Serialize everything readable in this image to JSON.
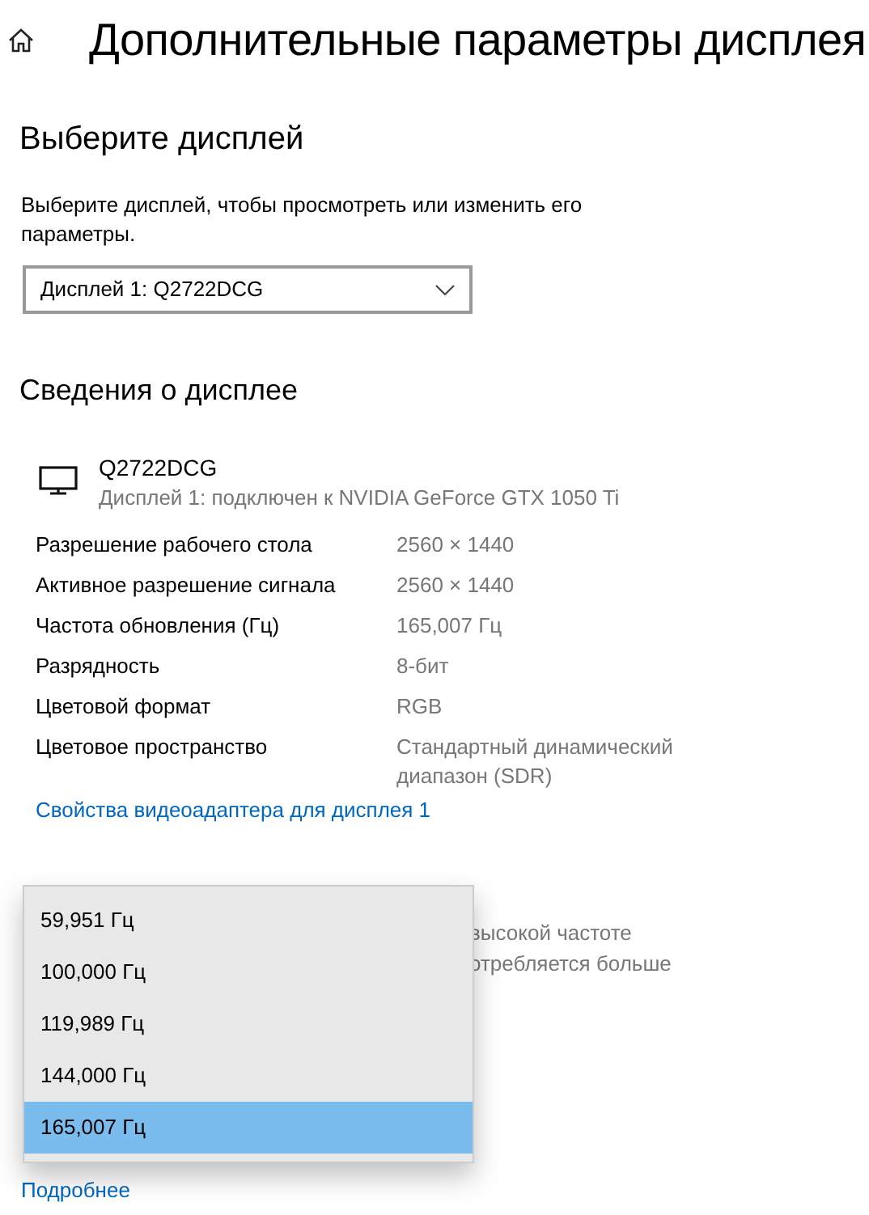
{
  "header": {
    "title": "Дополнительные параметры дисплея"
  },
  "choose_display": {
    "heading": "Выберите дисплей",
    "description": "Выберите дисплей, чтобы просмотреть или изменить его параметры.",
    "dropdown_value": "Дисплей 1: Q2722DCG"
  },
  "display_info": {
    "heading": "Сведения о дисплее",
    "monitor_name": "Q2722DCG",
    "monitor_detail": "Дисплей 1: подключен к NVIDIA GeForce GTX 1050 Ti",
    "rows": [
      {
        "label": "Разрешение рабочего стола",
        "value": "2560 × 1440"
      },
      {
        "label": "Активное разрешение сигнала",
        "value": "2560 × 1440"
      },
      {
        "label": "Частота обновления (Гц)",
        "value": "165,007 Гц"
      },
      {
        "label": "Разрядность",
        "value": "8-бит"
      },
      {
        "label": "Цветовой формат",
        "value": "RGB"
      },
      {
        "label": "Цветовое пространство",
        "value": "Стандартный динамический диапазон (SDR)"
      }
    ],
    "adapter_link": "Свойства видеоадаптера для дисплея 1"
  },
  "refresh_rate": {
    "description_fragments": [
      "высокой частоте",
      "отребляется больше"
    ],
    "options": [
      {
        "label": "59,951 Гц",
        "selected": false
      },
      {
        "label": "100,000 Гц",
        "selected": false
      },
      {
        "label": "119,989 Гц",
        "selected": false
      },
      {
        "label": "144,000 Гц",
        "selected": false
      },
      {
        "label": "165,007 Гц",
        "selected": true
      }
    ],
    "more_link": "Подробнее"
  }
}
